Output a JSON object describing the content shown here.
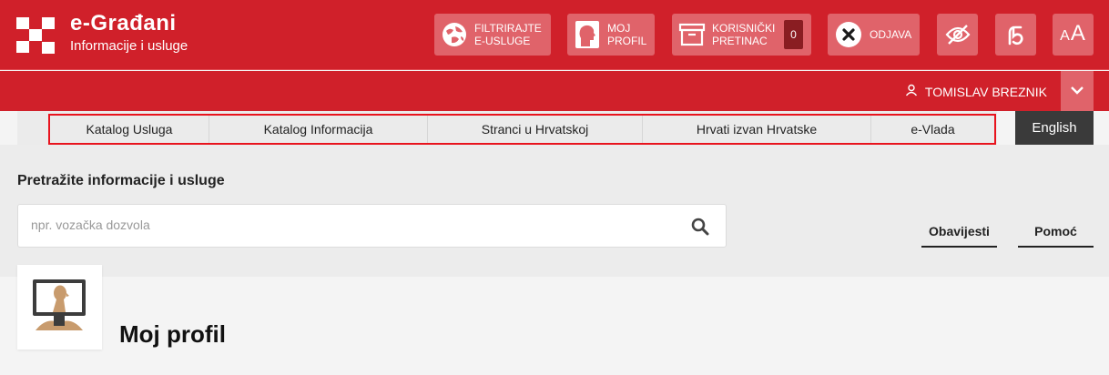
{
  "brand": {
    "title": "e-Građani",
    "subtitle": "Informacije i usluge"
  },
  "header": {
    "filter_label": "FILTRIRAJTE\nE-USLUGE",
    "profile_label": "MOJ\nPROFIL",
    "inbox_label": "KORISNIČKI\nPRETINAC",
    "inbox_count": "0",
    "logout_label": "ODJAVA",
    "font_size_label": "AA"
  },
  "user": {
    "name": "TOMISLAV BREZNIK"
  },
  "nav": {
    "items": [
      {
        "label": "Katalog Usluga"
      },
      {
        "label": "Katalog Informacija"
      },
      {
        "label": "Stranci u Hrvatskoj"
      },
      {
        "label": "Hrvati izvan Hrvatske"
      },
      {
        "label": "e-Vlada"
      }
    ],
    "language": "English"
  },
  "search": {
    "label": "Pretražite informacije i usluge",
    "placeholder": "npr. vozačka dozvola"
  },
  "tabs": {
    "notifications": "Obavijesti",
    "help": "Pomoć"
  },
  "profile": {
    "title": "Moj profil"
  },
  "colors": {
    "brand_red": "#d0202a",
    "button_red": "#e0636a",
    "highlight": "#e8141e"
  }
}
